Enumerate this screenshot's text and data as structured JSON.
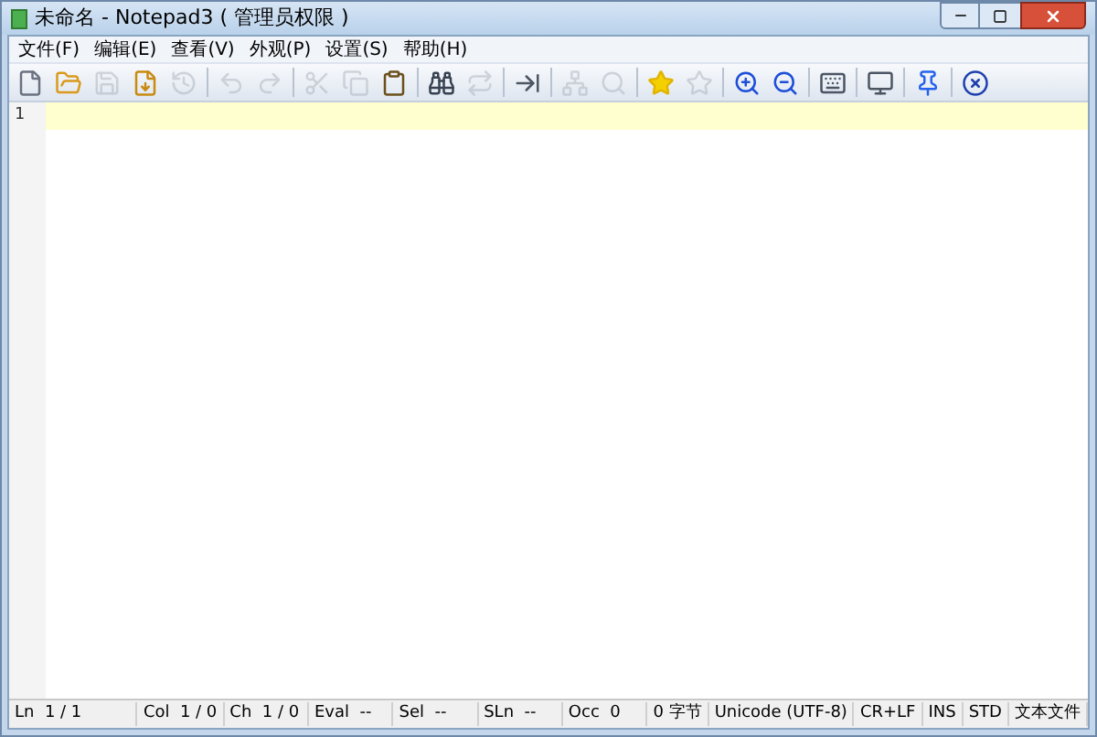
{
  "window": {
    "title": "未命名 - Notepad3 ( 管理员权限 )"
  },
  "menu": [
    "文件(F)",
    "编辑(E)",
    "查看(V)",
    "外观(P)",
    "设置(S)",
    "帮助(H)"
  ],
  "toolbar": [
    {
      "kind": "new",
      "disabled": false
    },
    {
      "kind": "open",
      "disabled": false
    },
    {
      "kind": "save",
      "disabled": true
    },
    {
      "kind": "save-as",
      "disabled": false
    },
    {
      "kind": "history",
      "disabled": true
    },
    {
      "kind": "sep"
    },
    {
      "kind": "undo",
      "disabled": true
    },
    {
      "kind": "redo",
      "disabled": true
    },
    {
      "kind": "sep"
    },
    {
      "kind": "cut",
      "disabled": true
    },
    {
      "kind": "copy",
      "disabled": true
    },
    {
      "kind": "paste",
      "disabled": false
    },
    {
      "kind": "sep"
    },
    {
      "kind": "find",
      "disabled": false
    },
    {
      "kind": "replace",
      "disabled": true
    },
    {
      "kind": "sep"
    },
    {
      "kind": "goto",
      "disabled": false
    },
    {
      "kind": "sep"
    },
    {
      "kind": "network",
      "disabled": true
    },
    {
      "kind": "search",
      "disabled": true
    },
    {
      "kind": "sep"
    },
    {
      "kind": "star",
      "disabled": false
    },
    {
      "kind": "star",
      "disabled": true
    },
    {
      "kind": "sep"
    },
    {
      "kind": "zoom-in",
      "disabled": false
    },
    {
      "kind": "zoom-out",
      "disabled": false
    },
    {
      "kind": "sep"
    },
    {
      "kind": "keyboard",
      "disabled": false
    },
    {
      "kind": "sep"
    },
    {
      "kind": "screen",
      "disabled": false
    },
    {
      "kind": "sep"
    },
    {
      "kind": "pin",
      "disabled": false
    },
    {
      "kind": "sep"
    },
    {
      "kind": "exit",
      "disabled": false
    }
  ],
  "editor": {
    "lines": [
      {
        "number": "1",
        "current": true
      }
    ]
  },
  "status_bar": [
    "Ln  1 / 1",
    "Col  1 / 0",
    "Ch  1 / 0",
    "Eval  --",
    "Sel  --",
    "SLn  --",
    "Occ  0",
    "0 字节",
    "Unicode (UTF-8)",
    "CR+LF",
    "INS",
    "STD",
    "文本文件"
  ]
}
